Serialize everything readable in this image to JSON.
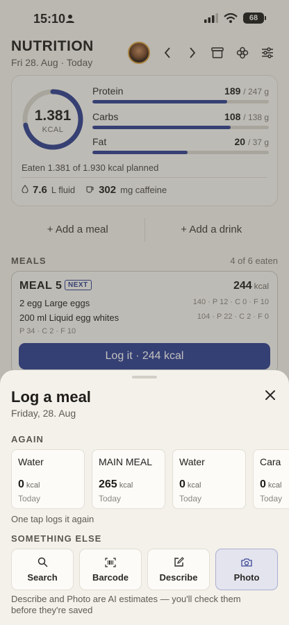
{
  "status_bar": {
    "time": "15:10",
    "battery": "68"
  },
  "header": {
    "title": "NUTRITION",
    "date": "Fri 28. Aug · Today"
  },
  "summary": {
    "kcal_value": "1.381",
    "kcal_unit": "KCAL",
    "kcal_progress": 0.716,
    "macros": [
      {
        "name": "Protein",
        "value": "189",
        "goal": "/ 247 g",
        "progress": 0.765
      },
      {
        "name": "Carbs",
        "value": "108",
        "goal": "/ 138 g",
        "progress": 0.783
      },
      {
        "name": "Fat",
        "value": "20",
        "goal": "/ 37 g",
        "progress": 0.54
      }
    ],
    "eaten_text": "Eaten 1.381 of 1.930 kcal planned",
    "fluid_value": "7.6",
    "fluid_unit": "L fluid",
    "caffeine_value": "302",
    "caffeine_unit": "mg caffeine"
  },
  "add_meal_label": "+ Add a meal",
  "add_drink_label": "+ Add a drink",
  "meals_section": {
    "label": "MEALS",
    "count": "4 of 6 eaten"
  },
  "meal_card": {
    "name": "MEAL 5",
    "badge": "NEXT",
    "kcal": "244",
    "kcal_unit": "kcal",
    "items": [
      {
        "name": "2 egg Large eggs",
        "macros": "140 · P 12 · C 0 · F 10"
      },
      {
        "name": "200 ml Liquid egg whites",
        "macros": "104 · P 22 · C 2 · F 0"
      }
    ],
    "totals": "P 34 · C 2 · F 10",
    "log_button": "Log it · 244 kcal"
  },
  "sheet": {
    "title": "Log a meal",
    "date": "Friday, 28. Aug",
    "again_label": "AGAIN",
    "recent": [
      {
        "name": "Water",
        "kcal": "0",
        "unit": "kcal",
        "when": "Today"
      },
      {
        "name": "MAIN MEAL",
        "kcal": "265",
        "unit": "kcal",
        "when": "Today"
      },
      {
        "name": "Water",
        "kcal": "0",
        "unit": "kcal",
        "when": "Today"
      },
      {
        "name": "Cara",
        "kcal": "0",
        "unit": "kcal",
        "when": "Today"
      }
    ],
    "one_tap_hint": "One tap logs it again",
    "something_else_label": "SOMETHING ELSE",
    "actions": [
      {
        "label": "Search",
        "icon": "search-icon"
      },
      {
        "label": "Barcode",
        "icon": "barcode-icon"
      },
      {
        "label": "Describe",
        "icon": "pencil-square-icon"
      },
      {
        "label": "Photo",
        "icon": "camera-icon",
        "selected": true
      }
    ],
    "disclaimer": "Describe and Photo are AI estimates — you'll check them before they're saved"
  },
  "colors": {
    "accent": "#2c3e91",
    "background": "#f4f2ec",
    "sheet": "#f3f1ea"
  }
}
